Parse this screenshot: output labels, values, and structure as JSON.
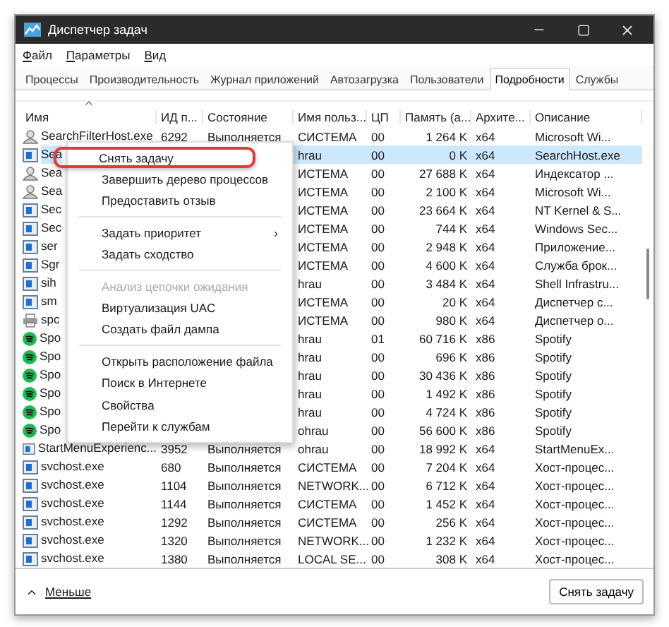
{
  "window": {
    "title": "Диспетчер задач"
  },
  "menu_bar": [
    "Файл",
    "Параметры",
    "Вид"
  ],
  "tabs": [
    {
      "label": "Процессы",
      "selected": false
    },
    {
      "label": "Производительность",
      "selected": false
    },
    {
      "label": "Журнал приложений",
      "selected": false
    },
    {
      "label": "Автозагрузка",
      "selected": false
    },
    {
      "label": "Пользователи",
      "selected": false
    },
    {
      "label": "Подробности",
      "selected": true
    },
    {
      "label": "Службы",
      "selected": false
    }
  ],
  "table": {
    "columns": [
      {
        "label": "Имя",
        "sorted": true
      },
      {
        "label": "ИД п...",
        "sorted": false
      },
      {
        "label": "Состояние",
        "sorted": false
      },
      {
        "label": "Имя польз...",
        "sorted": false
      },
      {
        "label": "ЦП",
        "sorted": false
      },
      {
        "label": "Память (а...",
        "sorted": false
      },
      {
        "label": "Архите...",
        "sorted": false
      },
      {
        "label": "Описание",
        "sorted": false
      }
    ],
    "rows": [
      {
        "kind": "user",
        "name": "SearchFilterHost.exe",
        "pid": "6292",
        "state": "Выполняется",
        "user": "СИСТЕМА",
        "cpu": "00",
        "memory": "1 264 K",
        "arch": "x64",
        "description": "Microsoft Wi...",
        "selected": false
      },
      {
        "kind": "process",
        "name": "Sea",
        "user": "hrau",
        "cpu": "00",
        "memory": "0 K",
        "arch": "x64",
        "description": "SearchHost.exe",
        "selected": true
      },
      {
        "kind": "user",
        "name": "Sea",
        "user": "ИСТЕМА",
        "cpu": "00",
        "memory": "27 688 K",
        "arch": "x64",
        "description": "Индексатор ...",
        "selected": false
      },
      {
        "kind": "user",
        "name": "Sea",
        "user": "ИСТЕМА",
        "cpu": "00",
        "memory": "2 100 K",
        "arch": "x64",
        "description": "Microsoft Wi...",
        "selected": false
      },
      {
        "kind": "process",
        "name": "Sec",
        "user": "ИСТЕМА",
        "cpu": "00",
        "memory": "23 664 K",
        "arch": "x64",
        "description": "NT Kernel & S...",
        "selected": false
      },
      {
        "kind": "process",
        "name": "Sec",
        "user": "ИСТЕМА",
        "cpu": "00",
        "memory": "744 K",
        "arch": "x64",
        "description": "Windows Sec...",
        "selected": false
      },
      {
        "kind": "process",
        "name": "ser",
        "user": "ИСТЕМА",
        "cpu": "00",
        "memory": "2 948 K",
        "arch": "x64",
        "description": "Приложение...",
        "selected": false
      },
      {
        "kind": "process",
        "name": "Sgr",
        "user": "ИСТЕМА",
        "cpu": "00",
        "memory": "4 600 K",
        "arch": "x64",
        "description": "Служба брок...",
        "selected": false
      },
      {
        "kind": "process",
        "name": "sih",
        "user": "hrau",
        "cpu": "00",
        "memory": "3 484 K",
        "arch": "x64",
        "description": "Shell Infrastru...",
        "selected": false
      },
      {
        "kind": "process",
        "name": "sm",
        "user": "ИСТЕМА",
        "cpu": "00",
        "memory": "20 K",
        "arch": "x64",
        "description": "Диспетчер с...",
        "selected": false
      },
      {
        "kind": "printer",
        "name": "spc",
        "user": "ИСТЕМА",
        "cpu": "00",
        "memory": "980 K",
        "arch": "x64",
        "description": "Диспетчер о...",
        "selected": false
      },
      {
        "kind": "music",
        "name": "Spo",
        "user": "hrau",
        "cpu": "01",
        "memory": "60 716 K",
        "arch": "x86",
        "description": "Spotify",
        "selected": false
      },
      {
        "kind": "music",
        "name": "Spo",
        "user": "hrau",
        "cpu": "00",
        "memory": "696 K",
        "arch": "x86",
        "description": "Spotify",
        "selected": false
      },
      {
        "kind": "music",
        "name": "Spo",
        "user": "hrau",
        "cpu": "00",
        "memory": "30 436 K",
        "arch": "x86",
        "description": "Spotify",
        "selected": false
      },
      {
        "kind": "music",
        "name": "Spo",
        "user": "hrau",
        "cpu": "00",
        "memory": "1 492 K",
        "arch": "x86",
        "description": "Spotify",
        "selected": false
      },
      {
        "kind": "music",
        "name": "Spo",
        "user": "hrau",
        "cpu": "00",
        "memory": "4 724 K",
        "arch": "x86",
        "description": "Spotify",
        "selected": false
      },
      {
        "kind": "music",
        "name": "Spo",
        "user": "ohrau",
        "cpu": "00",
        "memory": "56 600 K",
        "arch": "x86",
        "description": "Spotify",
        "selected": false
      },
      {
        "kind": "process",
        "name": "StartMenuExperienc...",
        "pid": "3952",
        "state": "Выполняется",
        "user": "ohrau",
        "cpu": "00",
        "memory": "18 992 K",
        "arch": "x64",
        "description": "StartMenuEx...",
        "selected": false
      },
      {
        "kind": "process",
        "name": "svchost.exe",
        "pid": "680",
        "state": "Выполняется",
        "user": "СИСТЕМА",
        "cpu": "00",
        "memory": "7 204 K",
        "arch": "x64",
        "description": "Хост-процес...",
        "selected": false
      },
      {
        "kind": "process",
        "name": "svchost.exe",
        "pid": "1104",
        "state": "Выполняется",
        "user": "NETWORK...",
        "cpu": "00",
        "memory": "6 712 K",
        "arch": "x64",
        "description": "Хост-процес...",
        "selected": false
      },
      {
        "kind": "process",
        "name": "svchost.exe",
        "pid": "1144",
        "state": "Выполняется",
        "user": "СИСТЕМА",
        "cpu": "00",
        "memory": "1 452 K",
        "arch": "x64",
        "description": "Хост-процес...",
        "selected": false
      },
      {
        "kind": "process",
        "name": "svchost.exe",
        "pid": "1292",
        "state": "Выполняется",
        "user": "СИСТЕМА",
        "cpu": "00",
        "memory": "256 K",
        "arch": "x64",
        "description": "Хост-процес...",
        "selected": false
      },
      {
        "kind": "process",
        "name": "svchost.exe",
        "pid": "1320",
        "state": "Выполняется",
        "user": "NETWORK...",
        "cpu": "00",
        "memory": "1 232 K",
        "arch": "x64",
        "description": "Хост-процес...",
        "selected": false
      },
      {
        "kind": "process",
        "name": "svchost.exe",
        "pid": "1380",
        "state": "Выполняется",
        "user": "LOCAL SE...",
        "cpu": "00",
        "memory": "308 K",
        "arch": "x64",
        "description": "Хост-процес...",
        "selected": false
      }
    ]
  },
  "context_menu": [
    {
      "kind": "item",
      "label": "Снять задачу",
      "highlighted": true
    },
    {
      "kind": "item",
      "label": "Завершить дерево процессов"
    },
    {
      "kind": "item",
      "label": "Предоставить отзыв"
    },
    {
      "kind": "separator"
    },
    {
      "kind": "submenu",
      "label": "Задать приоритет",
      "arrow": "›"
    },
    {
      "kind": "item",
      "label": "Задать сходство"
    },
    {
      "kind": "separator"
    },
    {
      "kind": "item",
      "label": "Анализ цепочки ожидания",
      "disabled": true
    },
    {
      "kind": "item",
      "label": "Виртуализация UAC"
    },
    {
      "kind": "item",
      "label": "Создать файл дампа"
    },
    {
      "kind": "separator"
    },
    {
      "kind": "item",
      "label": "Открыть расположение файла"
    },
    {
      "kind": "item",
      "label": "Поиск в Интернете"
    },
    {
      "kind": "item",
      "label": "Свойства"
    },
    {
      "kind": "item",
      "label": "Перейти к службам"
    }
  ],
  "footer": {
    "toggle": "Меньше",
    "button": "Снять задачу"
  }
}
